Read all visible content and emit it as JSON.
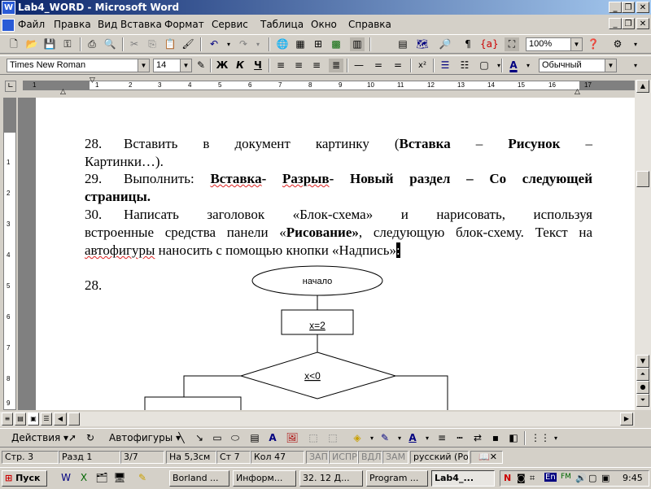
{
  "window": {
    "title": "Lab4_WORD - Microsoft Word",
    "app_icon": "W"
  },
  "menu": [
    "Файл",
    "Правка",
    "Вид",
    "Вставка",
    "Формат",
    "Сервис",
    "Таблица",
    "Окно",
    "Справка"
  ],
  "standard_toolbar": {
    "zoom": "100%"
  },
  "format_toolbar": {
    "font": "Times New Roman",
    "size": "14",
    "bold": "Ж",
    "italic": "К",
    "underline": "Ч",
    "superscript": "x²",
    "style": "Обычный"
  },
  "ruler": {
    "numbers": [
      "1",
      "1",
      "2",
      "3",
      "4",
      "5",
      "6",
      "7",
      "8",
      "9",
      "10",
      "11",
      "12",
      "13",
      "14",
      "15",
      "16",
      "17"
    ]
  },
  "vruler": {
    "numbers": [
      "1",
      "2",
      "3",
      "4",
      "5",
      "6",
      "7",
      "8",
      "9"
    ]
  },
  "document": {
    "p28_num": "28.",
    "p28_a": "Вставить в документ картинку (",
    "p28_b": "Вставка",
    "p28_c": " – ",
    "p28_d": "Рисунок",
    "p28_e": " –",
    "p28_line2": "Картинки…).",
    "p29_num": "29.",
    "p29_a": "Выполнить: ",
    "p29_b": "Вставка",
    "p29_c": "- ",
    "p29_d": "Разрыв",
    "p29_e": "- Новый раздел – Со следующей",
    "p29_line2": "страницы.",
    "p30_num": "30.",
    "p30_line1": "Написать заголовок «Блок-схема» и нарисовать, используя",
    "p30_a": "встроенные средства панели «",
    "p30_b": "Рисование»",
    "p30_c": ", следующую блок-схему. Текст на",
    "p30_d": "автофигуры",
    "p30_e": " наносить с помощью кнопки «Надпись»",
    "p30_cursor": ":",
    "list28": "28.",
    "flow_start": "начало",
    "flow_assign": "x=2",
    "flow_cond": "x<0"
  },
  "draw_toolbar": {
    "actions": "Действия",
    "autoshapes": "Автофигуры"
  },
  "status": {
    "page": "Стр. 3",
    "section": "Разд 1",
    "pages": "3/7",
    "at": "На 5,3см",
    "line": "Ст 7",
    "col": "Кол 47",
    "rec": "ЗАП",
    "trk": "ИСПР",
    "ext": "ВДЛ",
    "ovr": "ЗАМ",
    "lang": "русский (Ро"
  },
  "taskbar": {
    "start": "Пуск",
    "tasks": [
      "Borland ...",
      "Информ...",
      "32. 12 Д...",
      "Program ...",
      "Lab4_..."
    ],
    "tray_lang": "En",
    "clock": "9:45"
  }
}
